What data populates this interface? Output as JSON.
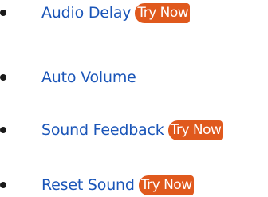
{
  "menu": {
    "items": [
      {
        "label": "Audio Delay",
        "badge": "Try Now"
      },
      {
        "label": "Auto Volume"
      },
      {
        "label": "Sound Feedback",
        "badge": "Try Now"
      },
      {
        "label": "Reset Sound",
        "badge": "Try Now"
      }
    ]
  },
  "colors": {
    "link": "#1a55b8",
    "badge_background": "#e0591d",
    "badge_text": "#ffffff",
    "bullet": "#1a1a1a"
  },
  "icons": {
    "bullet": "bullet-icon"
  }
}
